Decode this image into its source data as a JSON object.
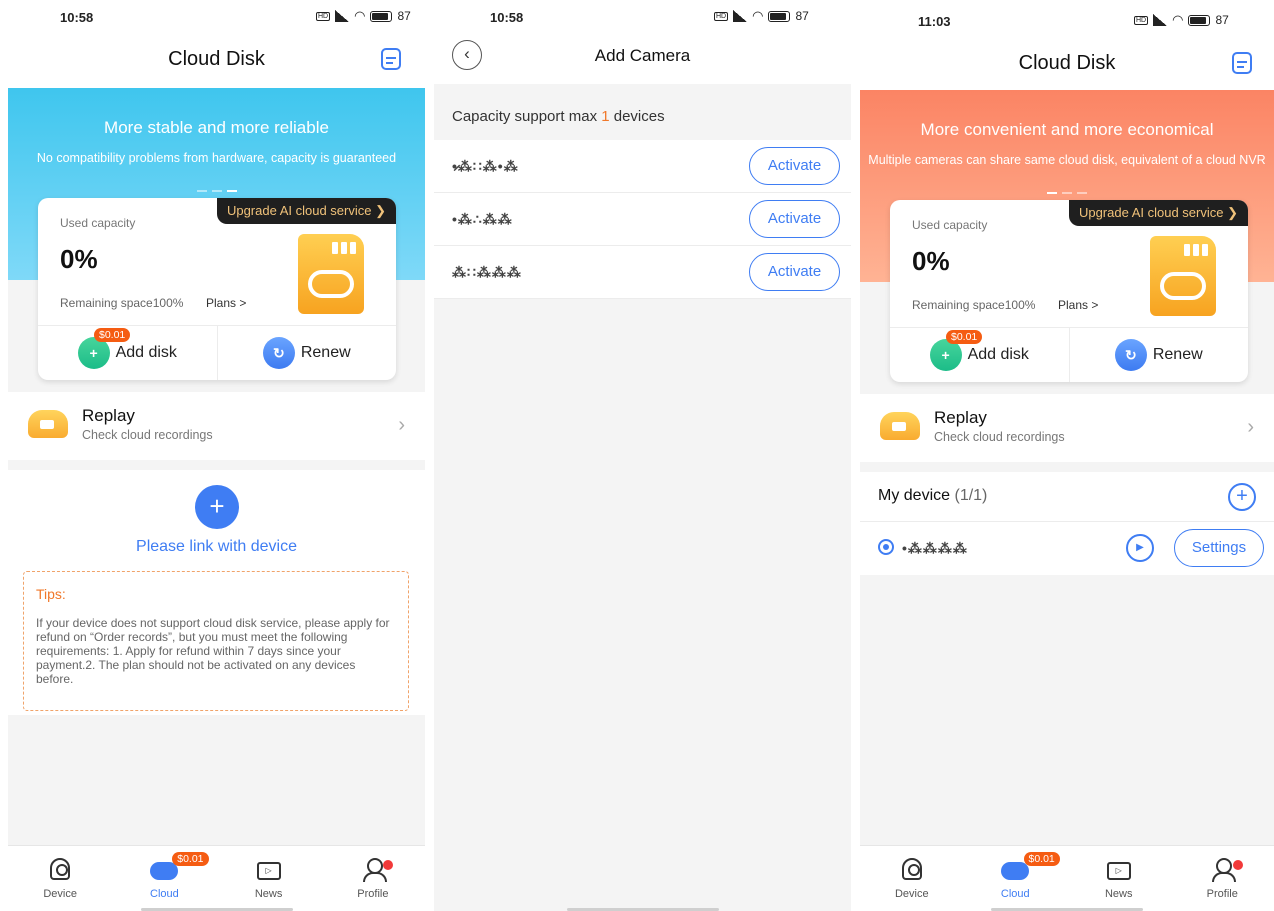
{
  "screen1": {
    "status": {
      "time": "10:58",
      "battery": "87"
    },
    "header": {
      "title": "Cloud Disk"
    },
    "banner": {
      "title": "More stable and more reliable",
      "subtitle": "No compatibility problems from hardware, capacity is guaranteed",
      "color": "#3fc6ee"
    },
    "card": {
      "upgrade_label": "Upgrade AI cloud service",
      "used_label": "Used capacity",
      "used_value": "0%",
      "remaining": "Remaining space100%",
      "plans": "Plans >",
      "add_disk": "Add disk",
      "add_disk_price": "$0.01",
      "renew": "Renew"
    },
    "replay": {
      "title": "Replay",
      "subtitle": "Check cloud recordings"
    },
    "link": {
      "text": "Please link with device"
    },
    "tips": {
      "title": "Tips:",
      "body": "If your device does not support cloud disk service, please apply for refund on “Order records”, but you must meet the following requirements: 1. Apply for refund within 7 days since your payment.2. The plan should not be activated on any devices before."
    }
  },
  "screen2": {
    "status": {
      "time": "10:58",
      "battery": "87"
    },
    "header": {
      "title": "Add Camera"
    },
    "capacity": {
      "prefix": "Capacity support max ",
      "count": "1",
      "suffix": " devices"
    },
    "devices": [
      {
        "id": "•̷⁂∷⁂•⁂",
        "action": "Activate"
      },
      {
        "id": "•⁂∴⁂⁂",
        "action": "Activate"
      },
      {
        "id": "⁂∷⁂⁂⁂",
        "action": "Activate"
      }
    ]
  },
  "screen3": {
    "status": {
      "time": "11:03",
      "battery": "87"
    },
    "header": {
      "title": "Cloud Disk"
    },
    "banner": {
      "title": "More convenient and more economical",
      "subtitle": "Multiple cameras can share same cloud disk, equivalent of a cloud NVR",
      "color": "#fb8464"
    },
    "card": {
      "upgrade_label": "Upgrade AI cloud service",
      "used_label": "Used capacity",
      "used_value": "0%",
      "remaining": "Remaining space100%",
      "plans": "Plans >",
      "add_disk": "Add disk",
      "add_disk_price": "$0.01",
      "renew": "Renew"
    },
    "replay": {
      "title": "Replay",
      "subtitle": "Check cloud recordings"
    },
    "mydevice": {
      "title": "My device",
      "count": "(1/1)",
      "device_id": "•⁂⁂⁂⁂",
      "settings": "Settings"
    }
  },
  "tabbar": {
    "cloud_price": "$0.01",
    "tabs": [
      "Device",
      "Cloud",
      "News",
      "Profile"
    ]
  },
  "colors": {
    "accent": "#3f7df3",
    "badge": "#f55c12",
    "tips": "#f0782a"
  }
}
